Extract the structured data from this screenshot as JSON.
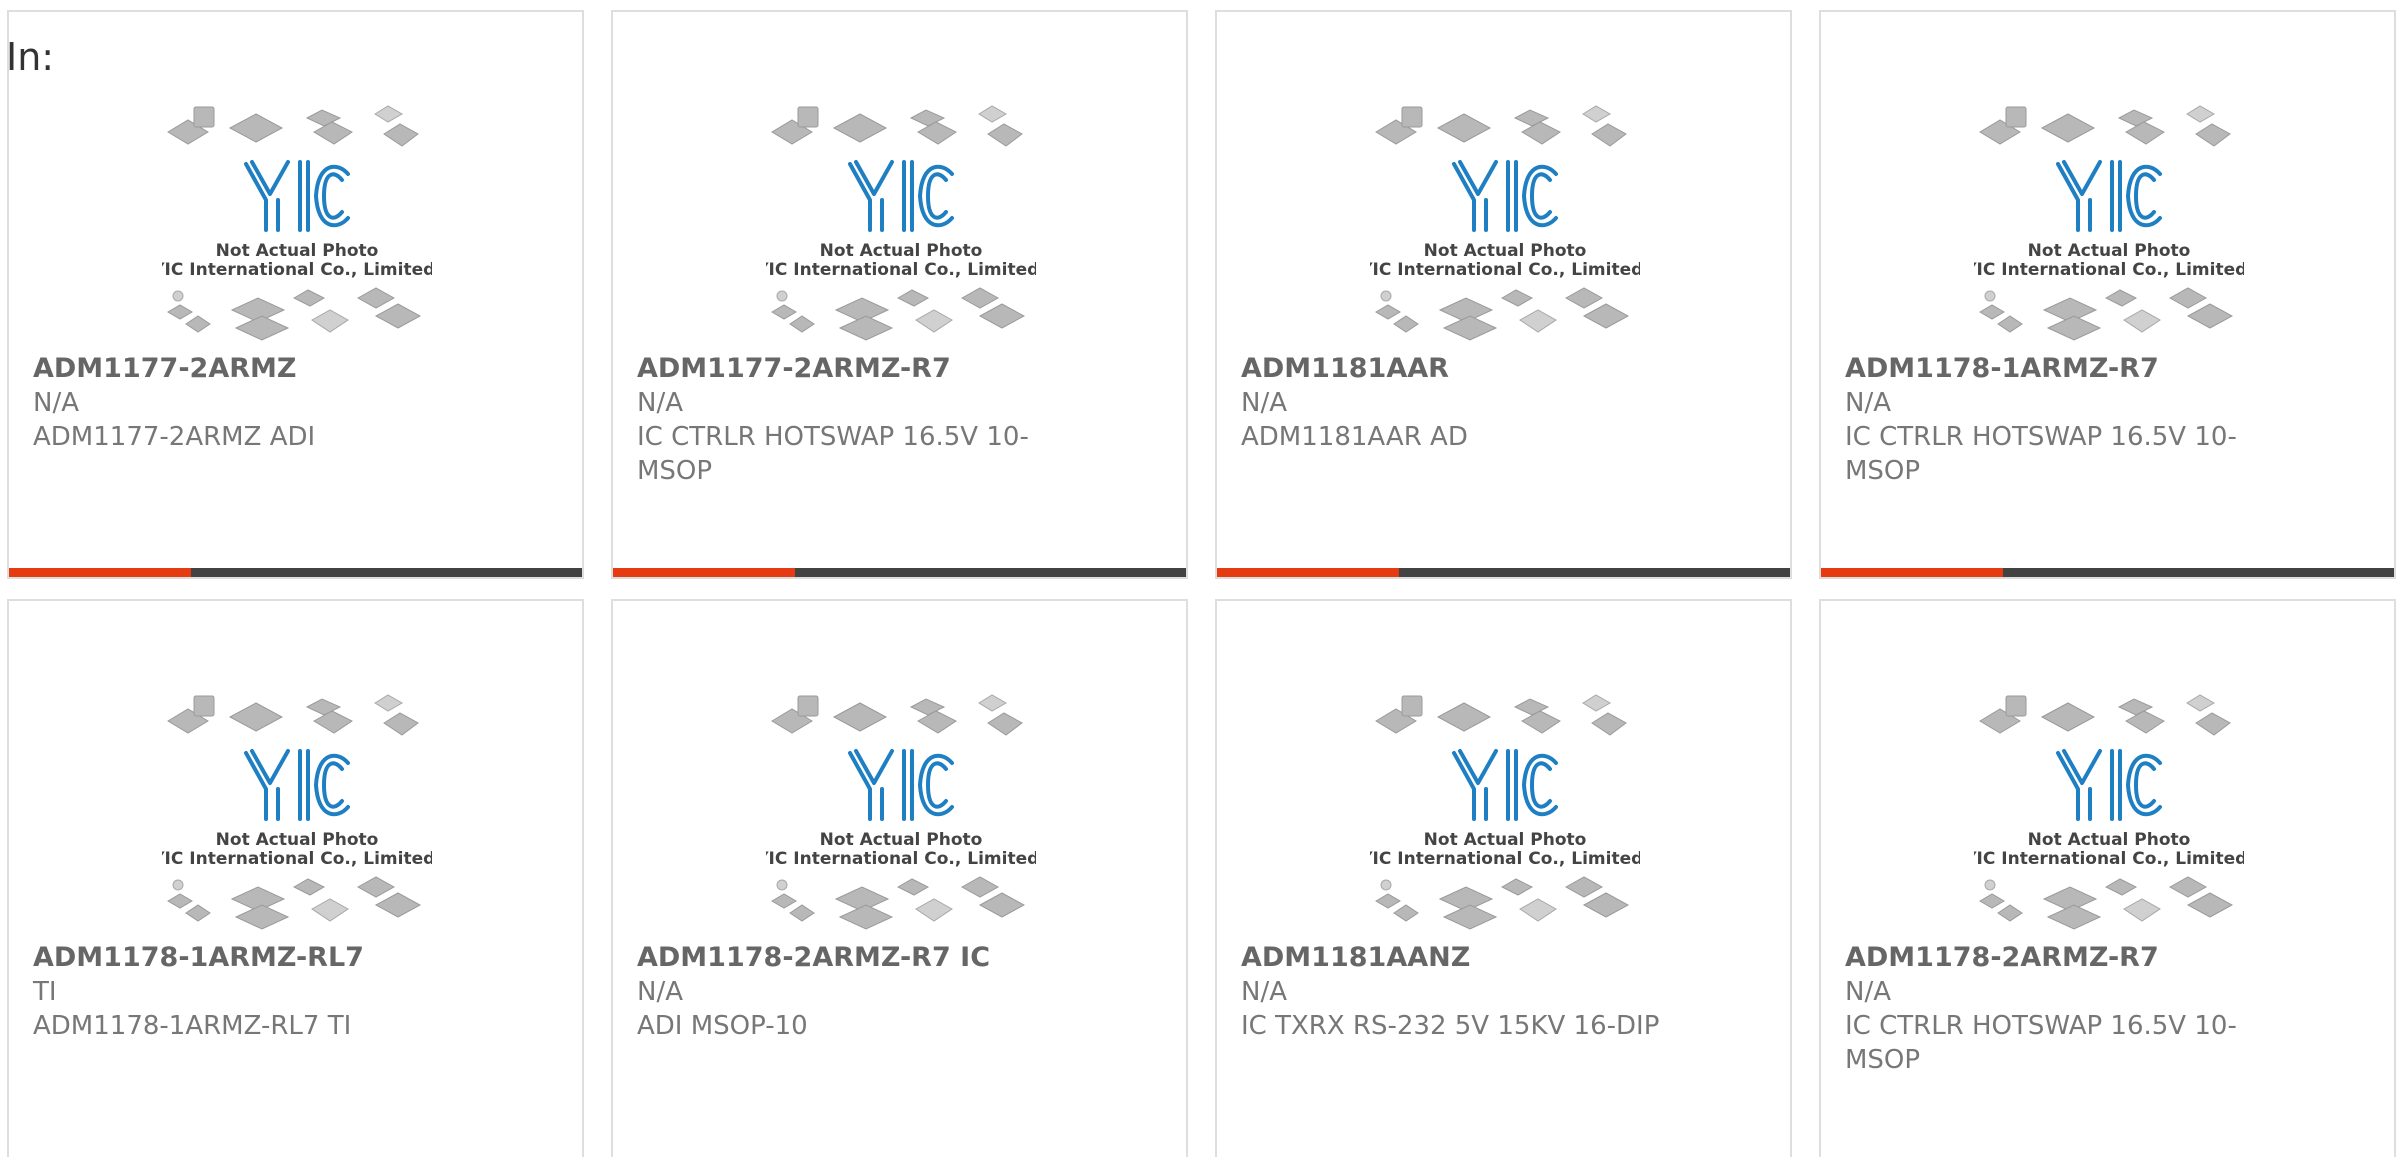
{
  "header": {
    "label": "In:"
  },
  "placeholder": {
    "logo_text": "YIC",
    "line1": "Not Actual Photo",
    "line2": "YIC International Co., Limited."
  },
  "colors": {
    "accent": "#e53b12",
    "bar": "#424242",
    "logo": "#1e7fc3"
  },
  "products": [
    {
      "part": "ADM1177-2ARMZ",
      "manufacturer": "N/A",
      "description": "ADM1177-2ARMZ ADI"
    },
    {
      "part": "ADM1177-2ARMZ-R7",
      "manufacturer": "N/A",
      "description": "IC CTRLR HOTSWAP 16.5V 10-MSOP"
    },
    {
      "part": "ADM1181AAR",
      "manufacturer": "N/A",
      "description": "ADM1181AAR AD"
    },
    {
      "part": "ADM1178-1ARMZ-R7",
      "manufacturer": "N/A",
      "description": "IC CTRLR HOTSWAP 16.5V 10-MSOP"
    },
    {
      "part": "ADM1178-1ARMZ-RL7",
      "manufacturer": "TI",
      "description": "ADM1178-1ARMZ-RL7 TI"
    },
    {
      "part": "ADM1178-2ARMZ-R7 IC",
      "manufacturer": "N/A",
      "description": "ADI MSOP-10"
    },
    {
      "part": "ADM1181AANZ",
      "manufacturer": "N/A",
      "description": "IC TXRX RS-232 5V 15KV 16-DIP"
    },
    {
      "part": "ADM1178-2ARMZ-R7",
      "manufacturer": "N/A",
      "description": "IC CTRLR HOTSWAP 16.5V 10-MSOP"
    }
  ]
}
